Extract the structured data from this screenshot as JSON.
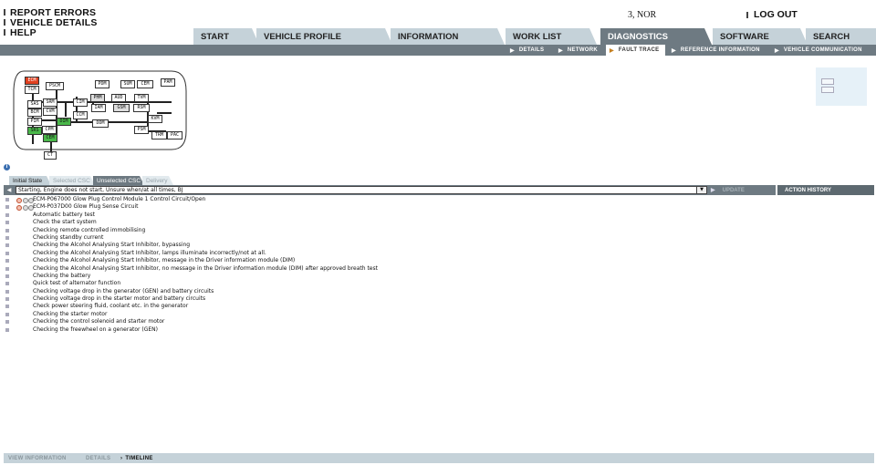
{
  "top_links": [
    "REPORT ERRORS",
    "VEHICLE DETAILS",
    "HELP"
  ],
  "user": "3, NOR",
  "logout": "LOG OUT",
  "tabs": [
    "START",
    "VEHICLE PROFILE",
    "INFORMATION",
    "WORK LIST",
    "DIAGNOSTICS",
    "SOFTWARE",
    "SEARCH"
  ],
  "subtabs": [
    "DETAILS",
    "NETWORK",
    "FAULT TRACE",
    "REFERENCE INFORMATION",
    "VEHICLE COMMUNICATION"
  ],
  "diagram_nodes": [
    "ECM",
    "TCM",
    "PSCM",
    "PDM",
    "SUM",
    "CEM",
    "PAM",
    "SAS",
    "SRM",
    "CIM",
    "PHM",
    "AUD",
    "TVM",
    "BCM",
    "CVM",
    "IAM",
    "GSM",
    "RSM",
    "CCM",
    "PIM",
    "DIM",
    "DDM",
    "KVM",
    "SRS",
    "CPM",
    "PSM",
    "CEM",
    "TRM",
    "PAC",
    "CT"
  ],
  "state_tabs": [
    "Initial State",
    "Selected CSC",
    "Unselected CSC",
    "Delivery"
  ],
  "combo_value": "Starting, Engine does not start, Unsure when/at all times, BJ",
  "update_label": "UPDATE",
  "action_history_label": "ACTION HISTORY",
  "items": [
    "ECM-P067000 Glow Plug Control Module 1 Control Circuit/Open",
    "ECM-P037D00 Glow Plug Sense Circuit",
    "Automatic battery test",
    "Check the start system",
    "Checking remote controlled immobilising",
    "Checking standby current",
    "Checking the Alcohol Analysing Start Inhibitor, bypassing",
    "Checking the Alcohol Analysing Start Inhibitor, lamps illuminate incorrectly/not at all.",
    "Checking the Alcohol Analysing Start Inhibitor, message in the Driver information module (DIM)",
    "Checking the Alcohol Analysing Start Inhibitor, no message in the Driver information module (DIM) after approved breath test",
    "Checking the battery",
    "Quick test of alternator function",
    "Checking voltage drop in the generator (GEN) and battery circuits",
    "Checking voltage drop in the starter motor and battery circuits",
    "Check power steering fluid, coolant etc. in the generator",
    "Checking the starter motor",
    "Checking the control solenoid and starter motor",
    "Checking the freewheel on a generator (GEN)"
  ],
  "bottom_items": [
    "VIEW INFORMATION",
    "DETAILS",
    "TIMELINE"
  ],
  "colors": {
    "accent": "#6e7a82",
    "tab_bg": "#c5d2d9",
    "fault_red": "#e04020",
    "ok_green": "#4ab84a"
  }
}
